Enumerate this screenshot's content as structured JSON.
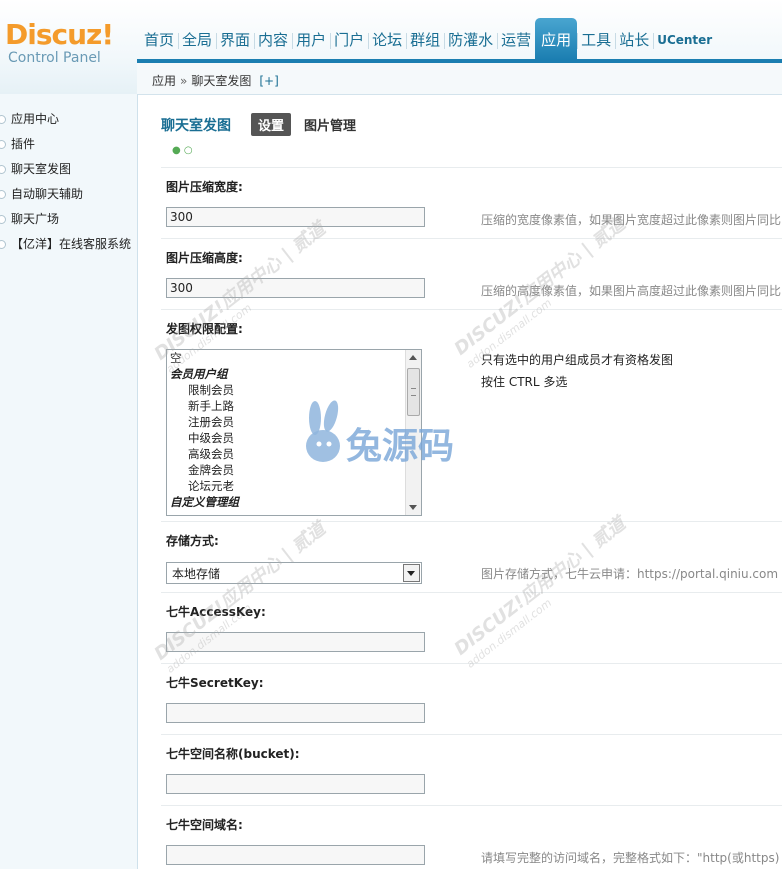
{
  "logo": {
    "brand": "Discuz",
    "bang": "!",
    "subtitle": "Control Panel"
  },
  "nav": {
    "items": [
      "首页",
      "全局",
      "界面",
      "内容",
      "用户",
      "门户",
      "论坛",
      "群组",
      "防灌水",
      "运营",
      "应用",
      "工具",
      "站长",
      "UCenter"
    ],
    "active": "应用"
  },
  "breadcrumb": {
    "root": "应用",
    "separator": "»",
    "current": "聊天室发图",
    "add": "[+]"
  },
  "sidebar": {
    "items": [
      "应用中心",
      "插件",
      "聊天室发图",
      "自动聊天辅助",
      "聊天广场",
      "【亿洋】在线客服系统"
    ]
  },
  "page": {
    "title": "聊天室发图",
    "tabs": [
      {
        "label": "设置",
        "active": true
      },
      {
        "label": "图片管理",
        "active": false
      }
    ]
  },
  "form": {
    "width": {
      "label": "图片压缩宽度:",
      "value": "300",
      "tip": "压缩的宽度像素值，如果图片宽度超过此像素则图片同比"
    },
    "height": {
      "label": "图片压缩高度:",
      "value": "300",
      "tip": "压缩的高度像素值，如果图片高度超过此像素则图片同比"
    },
    "permission": {
      "label": "发图权限配置:",
      "options": [
        {
          "text": "空",
          "kind": "plain"
        },
        {
          "text": "会员用户组",
          "kind": "group"
        },
        {
          "text": "限制会员",
          "kind": "sub"
        },
        {
          "text": "新手上路",
          "kind": "sub"
        },
        {
          "text": "注册会员",
          "kind": "sub"
        },
        {
          "text": "中级会员",
          "kind": "sub"
        },
        {
          "text": "高级会员",
          "kind": "sub"
        },
        {
          "text": "金牌会员",
          "kind": "sub"
        },
        {
          "text": "论坛元老",
          "kind": "sub"
        },
        {
          "text": "自定义管理组",
          "kind": "group"
        }
      ],
      "tip_line1": "只有选中的用户组成员才有资格发图",
      "tip_line2": "按住 CTRL 多选"
    },
    "storage": {
      "label": "存储方式:",
      "value": "本地存储",
      "tip": "图片存储方式，七牛云申请：https://portal.qiniu.com"
    },
    "access_key": {
      "label": "七牛AccessKey:",
      "value": ""
    },
    "secret_key": {
      "label": "七牛SecretKey:",
      "value": ""
    },
    "bucket": {
      "label": "七牛空间名称(bucket):",
      "value": ""
    },
    "domain": {
      "label": "七牛空间域名:",
      "value": "",
      "tip": "请填写完整的访问域名，完整格式如下：\"http(或https)"
    }
  },
  "watermarks": {
    "brand": "兔源码",
    "diag": "DISCUZ!应用中心 | 贰道",
    "diag_url": "addon.dismall.com"
  },
  "colors": {
    "nav_text": "#1a6e93",
    "active_nav": "#1b7eb1",
    "logo": "#f49b2b",
    "sidebar_bg": "#f2f8fb"
  }
}
